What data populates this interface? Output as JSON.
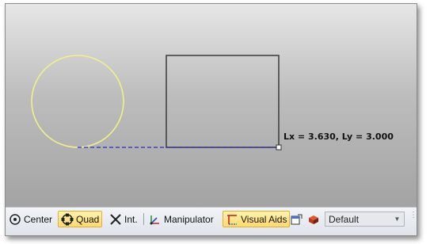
{
  "canvas": {
    "measurement_readout": "Lx = 3.630, Ly = 3.000",
    "circle_color": "#f2f08a",
    "rectangle_color": "#3a3a3a",
    "guide_line_color": "#2a2ad0"
  },
  "statusbar": {
    "items": [
      {
        "label": "Center",
        "icon": "center-snap-icon",
        "active": false
      },
      {
        "label": "Quad",
        "icon": "quad-snap-icon",
        "active": true
      },
      {
        "label": "Int.",
        "icon": "intersection-snap-icon",
        "active": false
      },
      {
        "label": "Manipulator",
        "icon": "manipulator-icon",
        "active": false
      },
      {
        "label": "Visual Aids",
        "icon": "visual-aids-icon",
        "active": true
      }
    ],
    "style_dropdown": {
      "value": "Default"
    },
    "active_color": "#ffd96a"
  }
}
